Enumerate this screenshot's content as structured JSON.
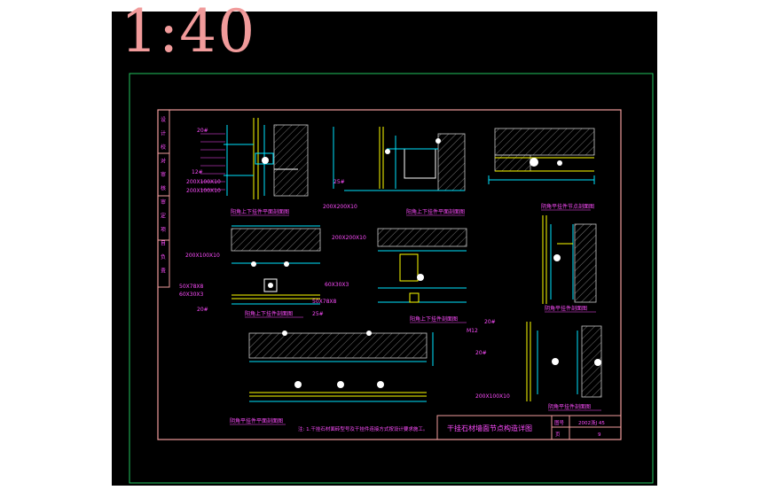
{
  "scale_label": "1:40",
  "colors": {
    "canvas_bg": "#000000",
    "outer_frame": "#22c55e",
    "inner_frame": "#f19b9b",
    "linework_cyan": "#00e5ff",
    "linework_yellow": "#ffff00",
    "linework_magenta": "#ff4dff",
    "linework_white": "#ffffff",
    "linework_green": "#33ff33",
    "scale_text": "#f19b9b"
  },
  "sidebar_labels": [
    "设",
    "计",
    "校",
    "对",
    "审",
    "核",
    "审",
    "定",
    "项",
    "目",
    "负",
    "责"
  ],
  "details": {
    "d1": {
      "caption": "阳角上下挂件平面剖面图",
      "labels": [
        "20#",
        "200X100X10",
        "12#",
        "200X100X10"
      ]
    },
    "d2": {
      "caption": "阳角上下挂件平面剖面图",
      "labels": [
        "25#",
        "200X200X10"
      ]
    },
    "d3": {
      "caption": "阴角平挂件节点剖面图",
      "labels": []
    },
    "d4": {
      "caption": "阳角上下挂件剖面图",
      "labels": [
        "200X100X10",
        "50X78X8",
        "60X30X3",
        "20#"
      ]
    },
    "d5": {
      "caption": "阳角上下挂件剖面图",
      "labels": [
        "200X200X10",
        "60X30X3",
        "50X78X8",
        "25#"
      ]
    },
    "d6": {
      "caption": "阴角平挂件剖面图",
      "labels": []
    },
    "d7": {
      "caption": "阴角平挂件平面剖面图",
      "labels": []
    },
    "d8": {
      "caption": "阴角平挂件剖面图",
      "labels": [
        "20#",
        "M12",
        "20#",
        "200X100X10"
      ]
    }
  },
  "note_text": "注: 1.干挂石材面砖型号及干挂件连接方式按设计要求施工。",
  "title_block": {
    "title": "干挂石材墙面节点构造详图",
    "drawing_no_label": "图号",
    "drawing_no_value": "2002浙J 45",
    "page_label": "页",
    "page_value": "9"
  }
}
